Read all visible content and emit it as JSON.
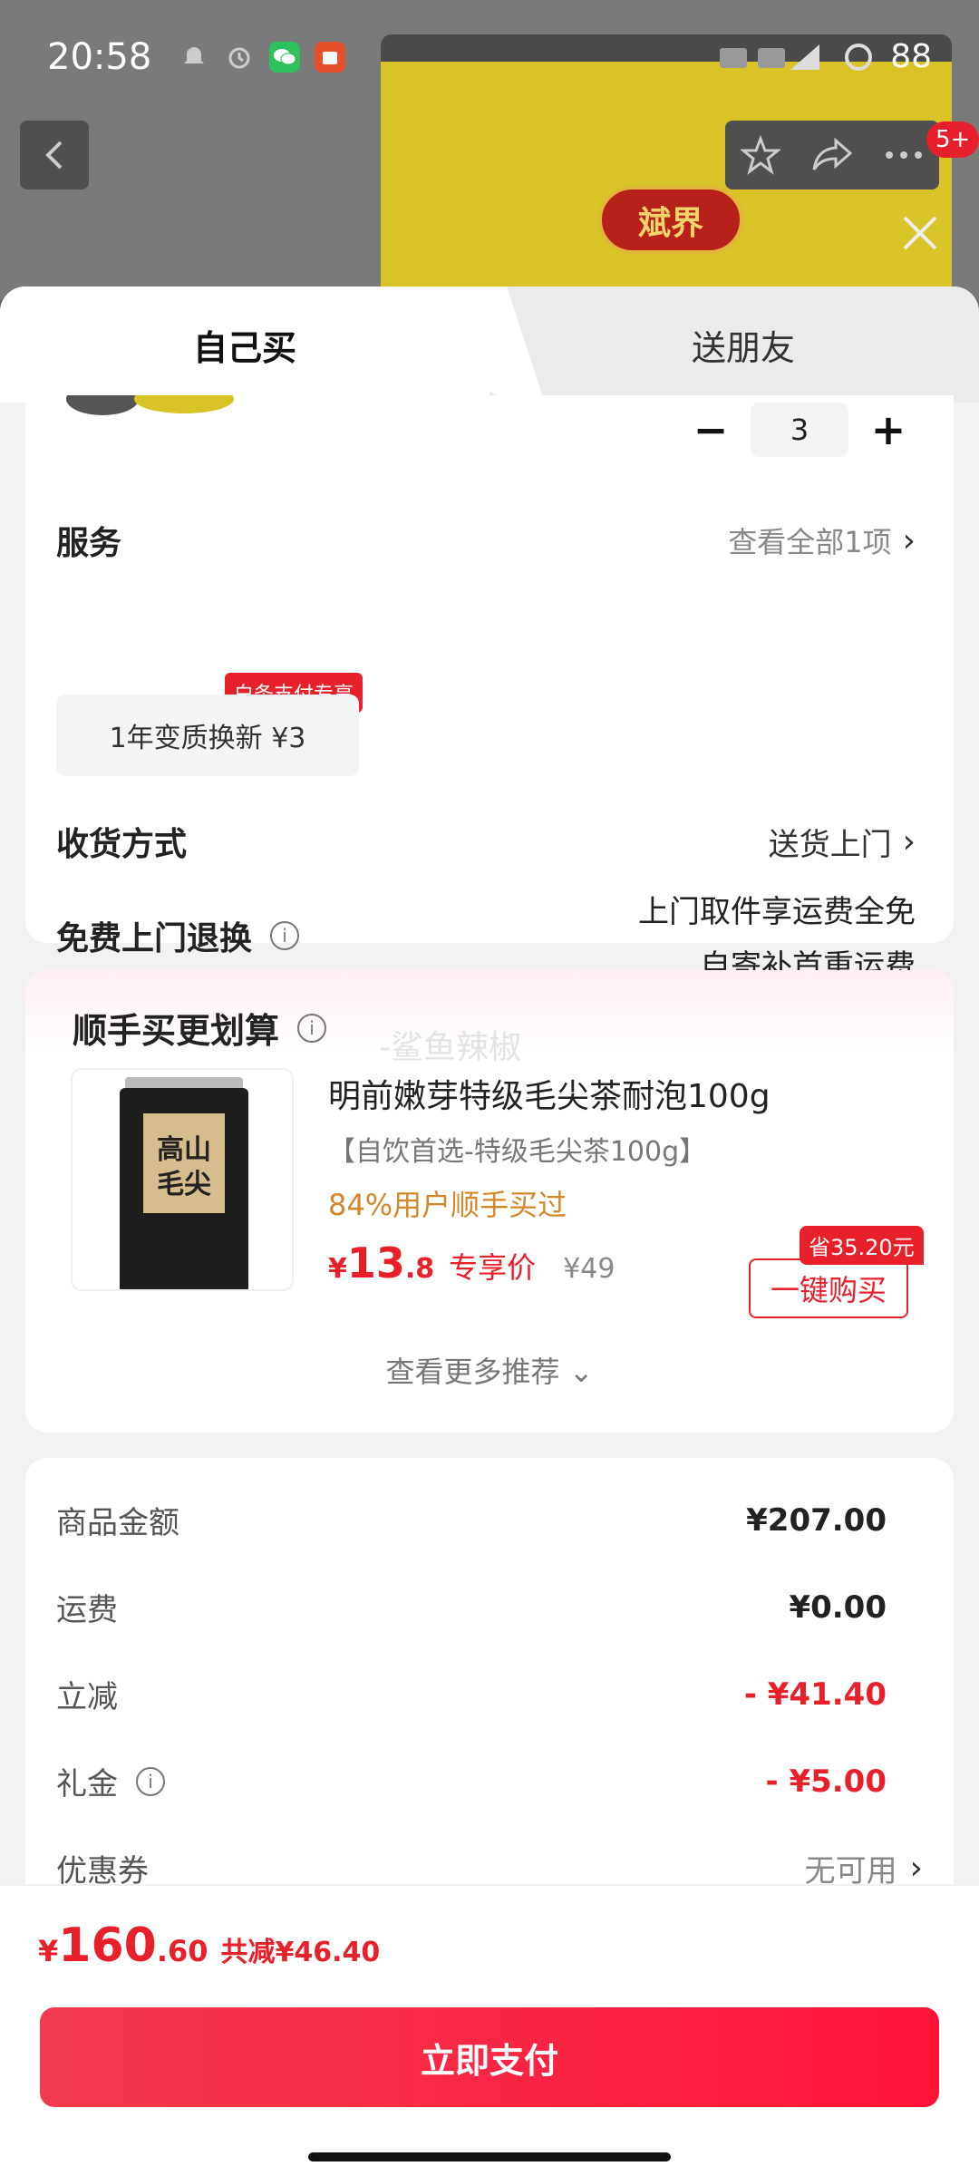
{
  "status_bar": {
    "time": "20:58",
    "battery": "88"
  },
  "background": {
    "brand_logo": "斌界",
    "cart_badge": "5+"
  },
  "tabs": {
    "self": "自己买",
    "friend": "送朋友"
  },
  "quantity": {
    "minus": "−",
    "value": "3",
    "plus": "+"
  },
  "service": {
    "label": "服务",
    "view_all": "查看全部1项",
    "chip_label": "1年变质换新  ¥3",
    "chip_tag": "白条支付专享"
  },
  "delivery": {
    "label": "收货方式",
    "value": "送货上门"
  },
  "free_return": {
    "label": "免费上门退换",
    "line1": "上门取件享运费全免",
    "line2": "自寄补首重运费"
  },
  "recommend": {
    "title": "顺手买更划算",
    "watermark": "-鲨鱼辣椒",
    "product_name": "明前嫩芽特级毛尖茶耐泡100g",
    "product_sub": "【自饮首选-特级毛尖茶100g】",
    "bought": "84%用户顺手买过",
    "price_currency": "¥",
    "price_int": "13",
    "price_dec": ".8",
    "price_label": "专享价",
    "orig_price": "¥49",
    "save_tag": "省35.20元",
    "buy_button": "一键购买",
    "more": "查看更多推荐",
    "can_text": "高山毛尖"
  },
  "fees": [
    {
      "label": "商品金额",
      "value": "¥207.00",
      "style": "normal"
    },
    {
      "label": "运费",
      "value": "¥0.00",
      "style": "normal"
    },
    {
      "label": "立减",
      "value": "- ¥41.40",
      "style": "red"
    },
    {
      "label": "礼金",
      "value": "- ¥5.00",
      "style": "red"
    },
    {
      "label": "优惠券",
      "value": "无可用",
      "style": "muted"
    }
  ],
  "bottom": {
    "currency": "¥",
    "total_int": "160",
    "total_dec": ".60",
    "saved": "共减¥46.40",
    "pay_button": "立即支付"
  },
  "colors": {
    "accent_red": "#e8202a",
    "bought_orange": "#d4862a"
  }
}
